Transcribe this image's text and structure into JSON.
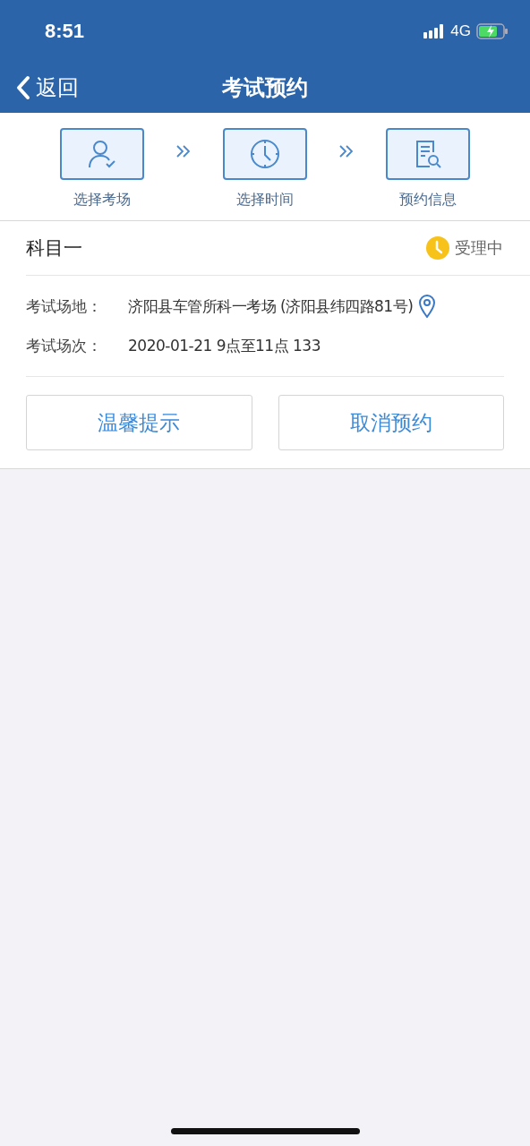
{
  "status_bar": {
    "time": "8:51",
    "network": "4G"
  },
  "nav": {
    "back": "返回",
    "title": "考试预约"
  },
  "steps": [
    {
      "kind": "person",
      "label": "选择考场"
    },
    {
      "kind": "clock",
      "label": "选择时间"
    },
    {
      "kind": "document",
      "label": "预约信息"
    }
  ],
  "booking": {
    "subject": "科目一",
    "status": "受理中",
    "fields": [
      {
        "label": "考试场地：",
        "value": "济阳县车管所科一考场 (济阳县纬四路81号)",
        "kind": "location"
      },
      {
        "label": "考试场次：",
        "value": "2020-01-21 9点至11点 133",
        "kind": "text"
      }
    ],
    "buttons": [
      "温馨提示",
      "取消预约"
    ]
  }
}
